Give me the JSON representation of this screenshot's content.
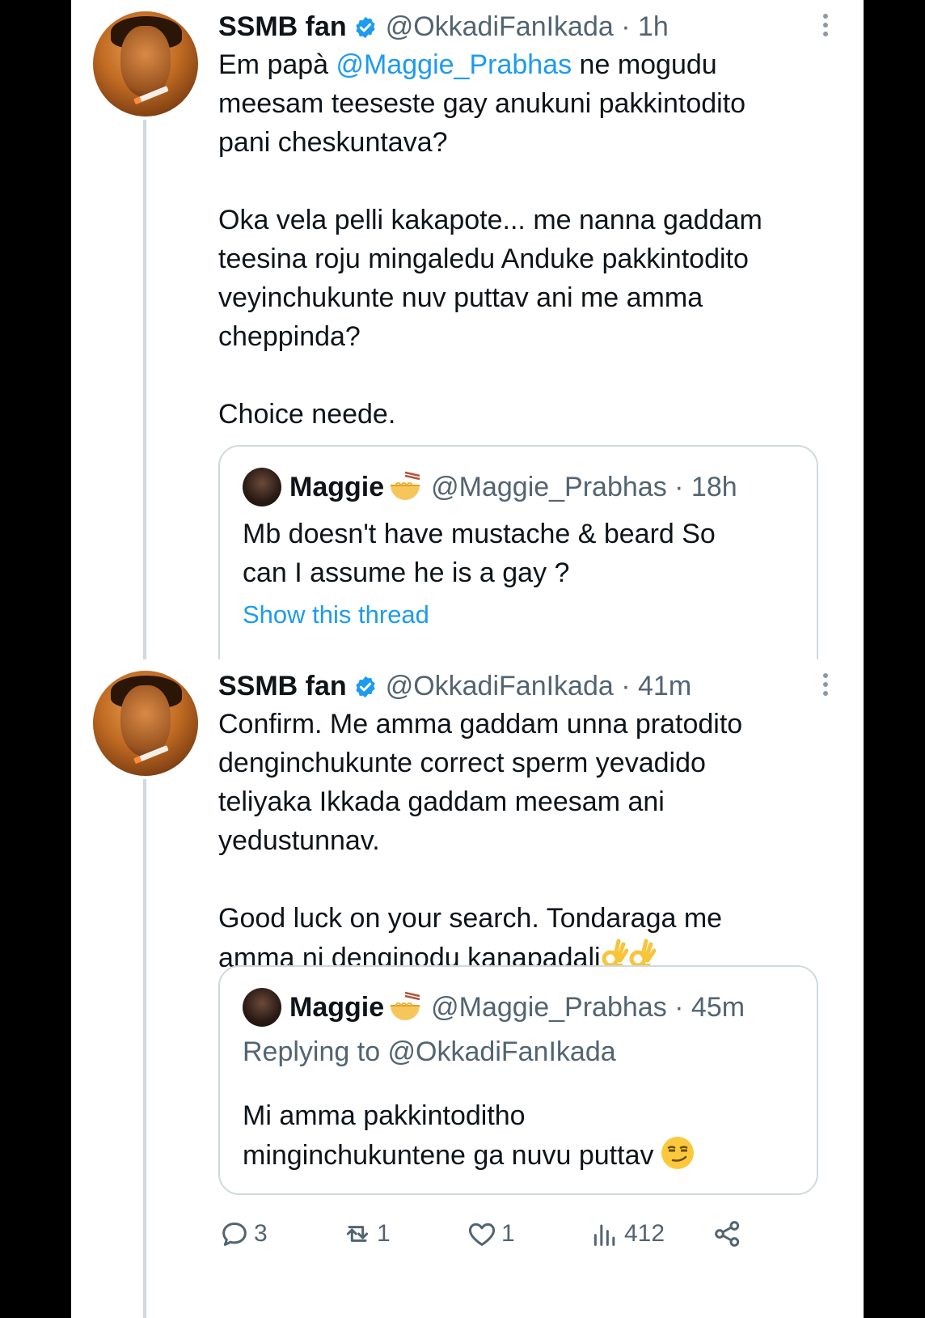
{
  "tweet1": {
    "author_name": "SSMB fan",
    "handle_time": "@OkkadiFanIkada · 1h",
    "text_before_mention": "Em papà ",
    "mention": "@Maggie_Prabhas",
    "text_after_mention": " ne mogudu\nmeesam teeseste gay anukuni pakkintodito\npani cheskuntava?\n\nOka vela pelli kakapote... me nanna gaddam\nteesina roju mingaledu Anduke pakkintodito\nveyinchukunte nuv puttav ani me amma\ncheppinda?\n\nChoice neede.",
    "quote": {
      "author_name": "Maggie",
      "handle_time": "@Maggie_Prabhas · 18h",
      "text": "Mb doesn't have mustache & beard So\ncan I assume he is a gay ?",
      "link": "Show this thread"
    }
  },
  "tweet2": {
    "author_name": "SSMB fan",
    "handle_time": "@OkkadiFanIkada · 41m",
    "text": "Confirm. Me amma gaddam unna pratodito\ndenginchukunte correct sperm yevadido\nteliyaka Ikkada gaddam meesam ani\nyedustunnav.\n\nGood luck on your search. Tondaraga me\namma ni denginodu kanapadali",
    "quote": {
      "author_name": "Maggie",
      "handle_time": "@Maggie_Prabhas · 45m",
      "replying_to": "Replying to @OkkadiFanIkada",
      "text": "Mi amma pakkintoditho\nminginchukuntene ga nuvu puttav"
    },
    "actions": {
      "replies": "3",
      "retweets": "1",
      "likes": "1",
      "views": "412"
    }
  },
  "icons": {
    "verified": "verified-badge-icon",
    "more": "more-options-icon",
    "reply": "reply-icon",
    "retweet": "retweet-icon",
    "like": "heart-icon",
    "views": "views-icon",
    "share": "share-icon",
    "noodle": "noodle-bowl-emoji",
    "ok_hand": "ok-hand-emoji",
    "smirk": "smirk-emoji"
  },
  "colors": {
    "link": "#1d9bf0",
    "secondary_text": "#536471",
    "border": "#cfd9de"
  }
}
